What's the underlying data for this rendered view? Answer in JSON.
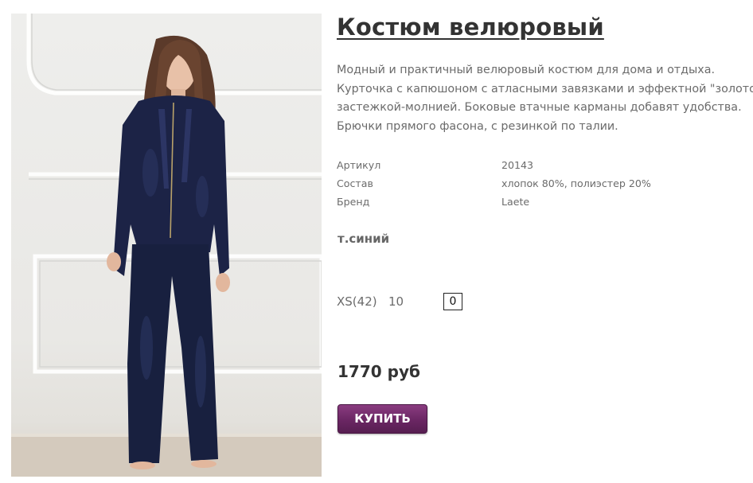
{
  "product": {
    "title": "Костюм велюровый",
    "description": [
      "Модный и практичный велюровый костюм для дома и отдыха.",
      "Курточка с капюшоном с атласными завязками и эффектной \"золотой\"",
      "застежкой-молнией. Боковые втачные карманы добавят удобства.",
      "Брючки прямого фасона, с резинкой по талии."
    ],
    "specs": [
      {
        "label": "Артикул",
        "value": "20143"
      },
      {
        "label": "Состав",
        "value": "хлопок 80%, полиэстер 20%"
      },
      {
        "label": "Бренд",
        "value": "Laete"
      }
    ],
    "color": "т.синий",
    "sizes": [
      {
        "size": "XS(42)",
        "stock": "10",
        "quantity": "0"
      }
    ],
    "price": "1770 руб",
    "buy_label": "КУПИТЬ"
  },
  "photo": {
    "icon": "product-photo",
    "alt": "model in navy velour hooded suit"
  },
  "colors": {
    "buy_button": "#6a2663",
    "title": "#333333",
    "text": "#6b6b6b"
  }
}
